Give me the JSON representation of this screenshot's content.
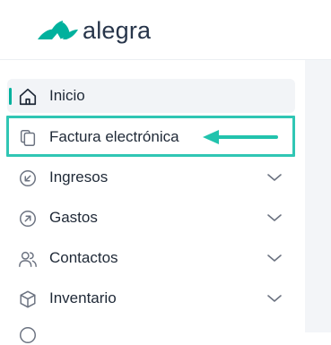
{
  "brand": {
    "name": "alegra",
    "accent_color": "#00b19d"
  },
  "sidebar": {
    "items": [
      {
        "label": "Inicio",
        "icon": "home-icon",
        "active": true,
        "has_submenu": false
      },
      {
        "label": "Factura electrónica",
        "icon": "documents-icon",
        "active": false,
        "has_submenu": false,
        "highlighted": true
      },
      {
        "label": "Ingresos",
        "icon": "arrow-down-left-circle-icon",
        "active": false,
        "has_submenu": true
      },
      {
        "label": "Gastos",
        "icon": "arrow-up-right-circle-icon",
        "active": false,
        "has_submenu": true
      },
      {
        "label": "Contactos",
        "icon": "users-icon",
        "active": false,
        "has_submenu": true
      },
      {
        "label": "Inventario",
        "icon": "box-icon",
        "active": false,
        "has_submenu": true
      }
    ]
  },
  "annotation": {
    "highlight_color": "#30c6b4",
    "arrow_color": "#22c3ad"
  }
}
